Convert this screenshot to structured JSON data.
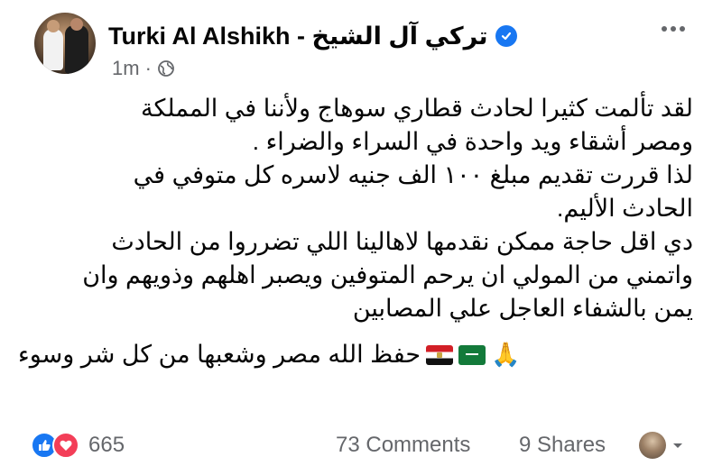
{
  "post": {
    "author": "Turki Al Alshikh - تركي آل الشيخ",
    "time": "1m",
    "separator": "·",
    "body_lines": [
      "لقد تألمت كثيرا لحادث قطاري سوهاج ولأننا في المملكة",
      "ومصر أشقاء ويد واحدة في السراء والضراء .",
      "لذا قررت تقديم  مبلغ ١٠٠ الف جنيه لاسره كل متوفي في",
      "الحادث الأليم.",
      "دي اقل حاجة ممكن نقدمها لاهالينا اللي تضرروا من الحادث",
      "واتمني من المولي ان يرحم المتوفين ويصبر اهلهم وذويهم وان",
      "يمن بالشفاء العاجل علي المصابين"
    ],
    "closing_line": "حفظ الله مصر وشعبها من كل شر وسوء",
    "closing_emojis": [
      "egypt-flag-icon",
      "saudi-flag-icon",
      "folded-hands-icon"
    ],
    "hands_emoji": "🙏"
  },
  "footer": {
    "reaction_count": "665",
    "comments": "73 Comments",
    "shares": "9 Shares"
  },
  "colors": {
    "verified": "#1877f2",
    "like": "#1877f2",
    "love": "#f33e58",
    "meta": "#65676b"
  }
}
